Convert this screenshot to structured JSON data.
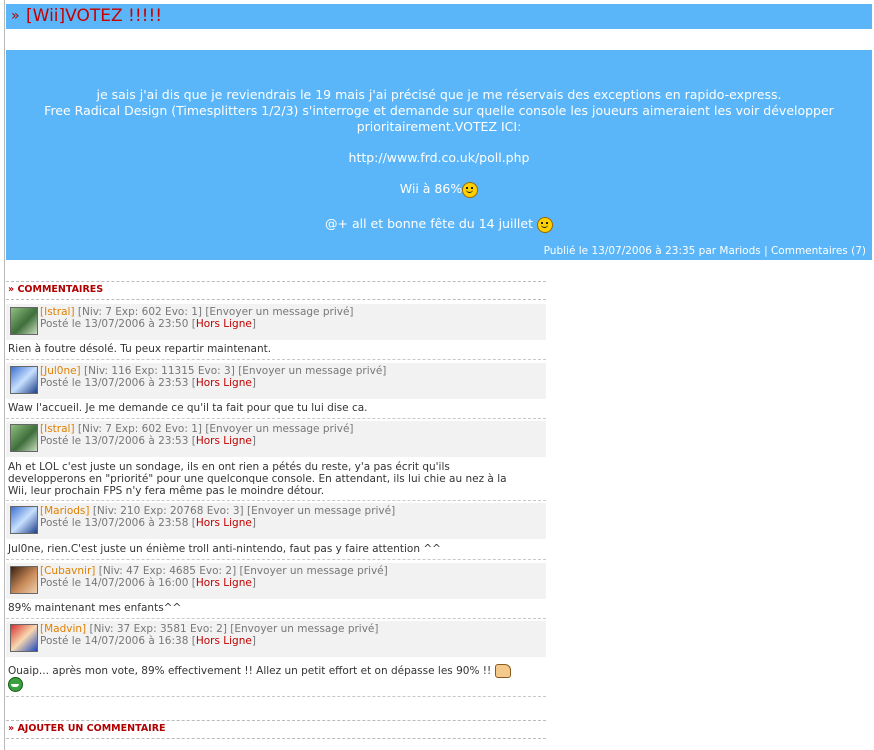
{
  "article": {
    "chevron": "»",
    "title": "[Wii]VOTEZ !!!!!",
    "body": [
      "je sais j'ai dis que je reviendrais le 19 mais j'ai précisé que je me réservais des exceptions en rapido-express.",
      "Free Radical Design (Timesplitters 1/2/3) s'interroge et demande sur quelle console les joueurs aimeraient les voir développer",
      "prioritairement.VOTEZ ICI:"
    ],
    "poll_url": "http://www.frd.co.uk/poll.php",
    "wii_percent": "Wii à 86%",
    "outro": "@+ all et bonne fête du 14 juillet",
    "published": "Publié le 13/07/2006 à 23:35 par Mariods",
    "separator": "|",
    "comments_link": "Commentaires (7)"
  },
  "comments_header": "» COMMENTAIRES",
  "add_comment_header": "» AJOUTER UN COMMENTAIRE",
  "comments": [
    {
      "user": "[Istral]",
      "stats": "[Niv: 7 Exp: 602 Evo: 1]",
      "pm": "[Envoyer un message privé]",
      "posted": "Posté le 13/07/2006 à 23:50",
      "status": "Hors Ligne",
      "text": "Rien à foutre désolé. Tu peux repartir maintenant."
    },
    {
      "user": "[Jul0ne]",
      "stats": "[Niv: 116 Exp: 11315 Evo: 3]",
      "pm": "[Envoyer un message privé]",
      "posted": "Posté le 13/07/2006 à 23:53",
      "status": "Hors Ligne",
      "text": "Waw l'accueil. Je me demande ce qu'il ta fait pour que tu lui dise ca."
    },
    {
      "user": "[Istral]",
      "stats": "[Niv: 7 Exp: 602 Evo: 1]",
      "pm": "[Envoyer un message privé]",
      "posted": "Posté le 13/07/2006 à 23:53",
      "status": "Hors Ligne",
      "text_lines": [
        "Ah et LOL c'est juste un sondage, ils en ont rien a pétés du reste, y'a pas écrit qu'ils",
        "developperons en \"priorité\" pour une quelconque console. En attendant, ils lui chie au nez à la",
        "Wii, leur prochain FPS n'y fera même pas le moindre détour."
      ]
    },
    {
      "user": "[Mariods]",
      "stats": "[Niv: 210 Exp: 20768 Evo: 3]",
      "pm": "[Envoyer un message privé]",
      "posted": "Posté le 13/07/2006 à 23:58",
      "status": "Hors Ligne",
      "text": "Jul0ne, rien.C'est juste un énième troll anti-nintendo, faut pas y faire attention ^^"
    },
    {
      "user": "[Cubavnir]",
      "stats": "[Niv: 47 Exp: 4685 Evo: 2]",
      "pm": "[Envoyer un message privé]",
      "posted": "Posté le 14/07/2006 à 16:00",
      "status": "Hors Ligne",
      "text": "89% maintenant mes enfants^^"
    },
    {
      "user": "[Madvin]",
      "stats": "[Niv: 37 Exp: 3581 Evo: 2]",
      "pm": "[Envoyer un message privé]",
      "posted": "Posté le 14/07/2006 à 16:38",
      "status": "Hors Ligne",
      "text": "Ouaip... après mon vote, 89% effectivement !! Allez un petit effort et on dépasse les 90% !!"
    }
  ],
  "icons": {
    "smiley": "smiley-icon",
    "wink": "wink-icon",
    "thumb": "thumbs-up-icon",
    "grin": "grin-icon"
  },
  "colors": {
    "banner": "#5ab6f8",
    "title_red": "#c80000",
    "username_orange": "#e08000",
    "offline_red": "#c00000"
  }
}
